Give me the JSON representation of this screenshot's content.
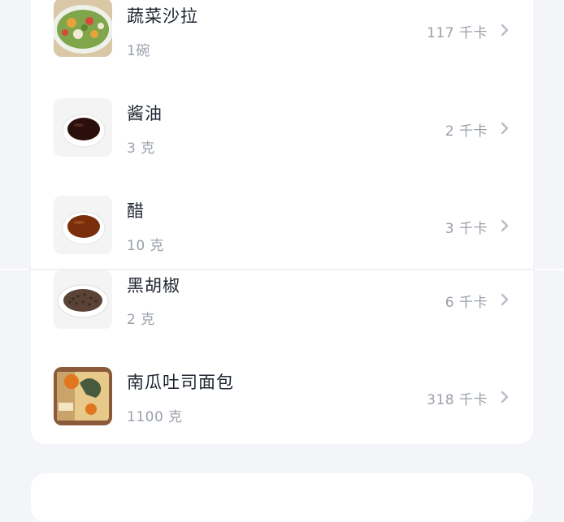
{
  "foods": [
    {
      "name": "蔬菜沙拉",
      "amount": "1碗",
      "kcal": "117 千卡",
      "thumb": "salad-bowl-photo"
    },
    {
      "name": "酱油",
      "amount": "3 克",
      "kcal": "2 千卡",
      "thumb": "soy-sauce-dish-photo"
    },
    {
      "name": "醋",
      "amount": "10 克",
      "kcal": "3 千卡",
      "thumb": "vinegar-dish-photo"
    },
    {
      "name": "黑胡椒",
      "amount": "2 克",
      "kcal": "6 千卡",
      "thumb": "black-pepper-plate-photo"
    },
    {
      "name": "南瓜吐司面包",
      "amount": "1100 克",
      "kcal": "318 千卡",
      "thumb": "pumpkin-toast-bag-photo"
    }
  ],
  "icons": {
    "row_arrow": "chevron-right-icon"
  },
  "colors": {
    "background": "#f4f5f9",
    "card": "#ffffff",
    "title": "#1e2430",
    "secondary": "#9aa0aa"
  }
}
